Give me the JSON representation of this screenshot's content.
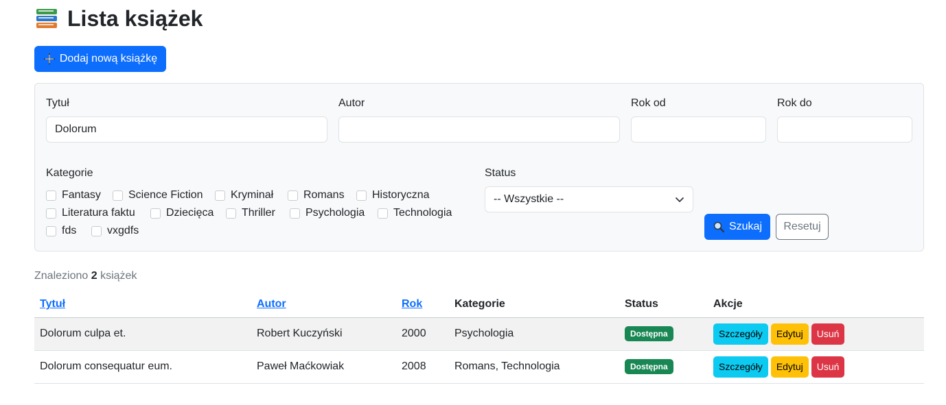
{
  "page": {
    "title": "Lista książek",
    "add_button": "Dodaj nową książkę"
  },
  "filters": {
    "title_label": "Tytuł",
    "title_value": "Dolorum",
    "author_label": "Autor",
    "author_value": "",
    "year_from_label": "Rok od",
    "year_from_value": "",
    "year_to_label": "Rok do",
    "year_to_value": "",
    "categories_label": "Kategorie",
    "categories": [
      {
        "label": "Fantasy",
        "checked": false
      },
      {
        "label": "Science Fiction",
        "checked": false
      },
      {
        "label": "Kryminał",
        "checked": false
      },
      {
        "label": "Romans",
        "checked": false
      },
      {
        "label": "Historyczna",
        "checked": false
      },
      {
        "label": "Literatura faktu",
        "checked": false
      },
      {
        "label": "Dziecięca",
        "checked": false
      },
      {
        "label": "Thriller",
        "checked": false
      },
      {
        "label": "Psychologia",
        "checked": false
      },
      {
        "label": "Technologia",
        "checked": false
      },
      {
        "label": "fds",
        "checked": false
      },
      {
        "label": "vxgdfs",
        "checked": false
      }
    ],
    "status_label": "Status",
    "status_selected": "-- Wszystkie --",
    "search_button": "Szukaj",
    "reset_button": "Resetuj"
  },
  "results": {
    "prefix": "Znaleziono",
    "count": "2",
    "suffix": "książek"
  },
  "table": {
    "headers": {
      "title": "Tytuł",
      "author": "Autor",
      "year": "Rok",
      "categories": "Kategorie",
      "status": "Status",
      "actions": "Akcje"
    },
    "rows": [
      {
        "title": "Dolorum culpa et.",
        "author": "Robert Kuczyński",
        "year": "2000",
        "categories": "Psychologia",
        "status": "Dostępna"
      },
      {
        "title": "Dolorum consequatur eum.",
        "author": "Paweł Maćkowiak",
        "year": "2008",
        "categories": "Romans, Technologia",
        "status": "Dostępna"
      }
    ],
    "actions": {
      "details": "Szczegóły",
      "edit": "Edytuj",
      "delete": "Usuń"
    }
  },
  "colors": {
    "primary": "#0d6efd",
    "success": "#198754",
    "info": "#0dcaf0",
    "warning": "#ffc107",
    "danger": "#dc3545",
    "secondary": "#6c757d"
  },
  "icons": {
    "title": "books-icon",
    "add": "plus-icon",
    "search": "magnifier-icon",
    "select": "chevron-down-icon"
  }
}
